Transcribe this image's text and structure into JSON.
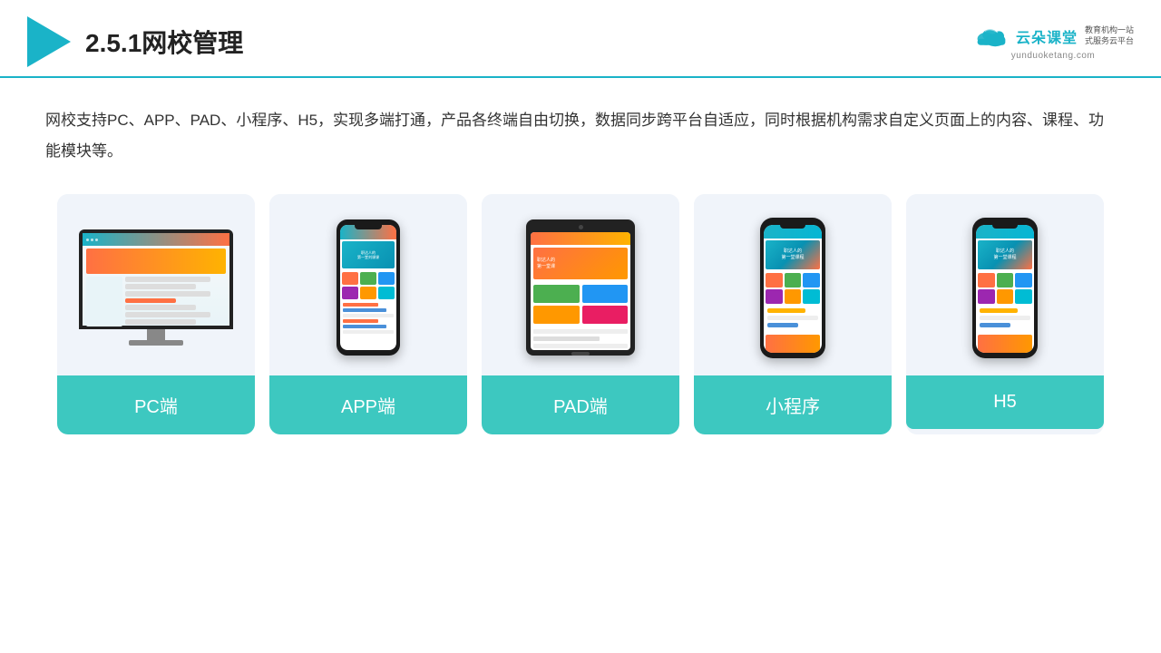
{
  "header": {
    "title": "2.5.1网校管理",
    "brand": {
      "name": "云朵课堂",
      "url": "yunduoketang.com",
      "tagline1": "教育机构一站",
      "tagline2": "式服务云平台"
    }
  },
  "description": {
    "text": "网校支持PC、APP、PAD、小程序、H5，实现多端打通，产品各终端自由切换，数据同步跨平台自适应，同时根据机构需求自定义页面上的内容、课程、功能模块等。"
  },
  "cards": [
    {
      "id": "pc",
      "label": "PC端"
    },
    {
      "id": "app",
      "label": "APP端"
    },
    {
      "id": "pad",
      "label": "PAD端"
    },
    {
      "id": "miniprogram",
      "label": "小程序"
    },
    {
      "id": "h5",
      "label": "H5"
    }
  ],
  "colors": {
    "accent": "#1ab3c8",
    "card_label_bg": "#3dc8c0",
    "card_bg": "#f0f4fa"
  }
}
